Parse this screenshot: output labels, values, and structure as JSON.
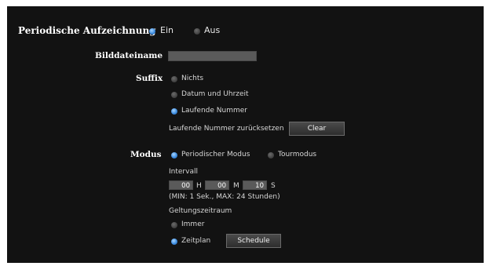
{
  "periodic": {
    "label": "Periodische Aufzeichnung",
    "on_label": "Ein",
    "off_label": "Aus",
    "selected": "on"
  },
  "filename": {
    "label": "Bilddateiname",
    "value": ""
  },
  "suffix": {
    "label": "Suffix",
    "options": [
      "Nichts",
      "Datum und Uhrzeit",
      "Laufende Nummer"
    ],
    "selected": "Laufende Nummer",
    "reset_label": "Laufende Nummer zurücksetzen",
    "clear_button": "Clear"
  },
  "mode": {
    "label": "Modus",
    "options": [
      "Periodischer Modus",
      "Tourmodus"
    ],
    "selected": "Periodischer Modus",
    "interval_label": "Intervall",
    "hours": "00",
    "hours_unit": "H",
    "minutes": "00",
    "minutes_unit": "M",
    "seconds": "10",
    "seconds_unit": "S",
    "range_note": "(MIN: 1 Sek., MAX: 24 Stunden)",
    "validity_label": "Geltungszeitraum",
    "validity_options": [
      "Immer",
      "Zeitplan"
    ],
    "validity_selected": "Zeitplan",
    "schedule_button": "Schedule"
  },
  "colors": {
    "panel_bg": "#121212",
    "radio_selected": "#3e8de0",
    "radio_unselected": "#3e3e3e",
    "field_bg": "#5a5a5a"
  }
}
